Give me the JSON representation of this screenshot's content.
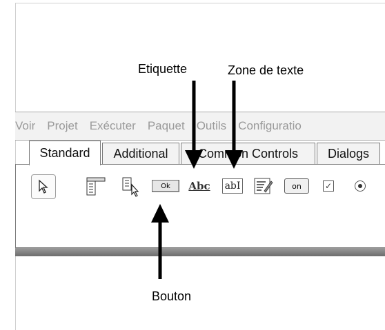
{
  "annotations": {
    "etiquette": "Etiquette",
    "zone_de_texte": "Zone de texte",
    "bouton": "Bouton"
  },
  "menu": {
    "items": [
      "Voir",
      "Projet",
      "Exécuter",
      "Paquet",
      "Outils",
      "Configuratio"
    ]
  },
  "tabs": [
    {
      "label": "Standard",
      "active": true
    },
    {
      "label": "Additional",
      "active": false
    },
    {
      "label": "Common Controls",
      "active": false
    },
    {
      "label": "Dialogs",
      "active": false
    }
  ],
  "palette": {
    "ok_label": "Ok",
    "abc_label": "Abc",
    "edit_label": "abI",
    "on_label": "on",
    "check_mark": "✓"
  },
  "colors": {
    "menu_text": "#9a9a9a",
    "tab_border": "#7a7a7a",
    "arrow": "#000000"
  }
}
